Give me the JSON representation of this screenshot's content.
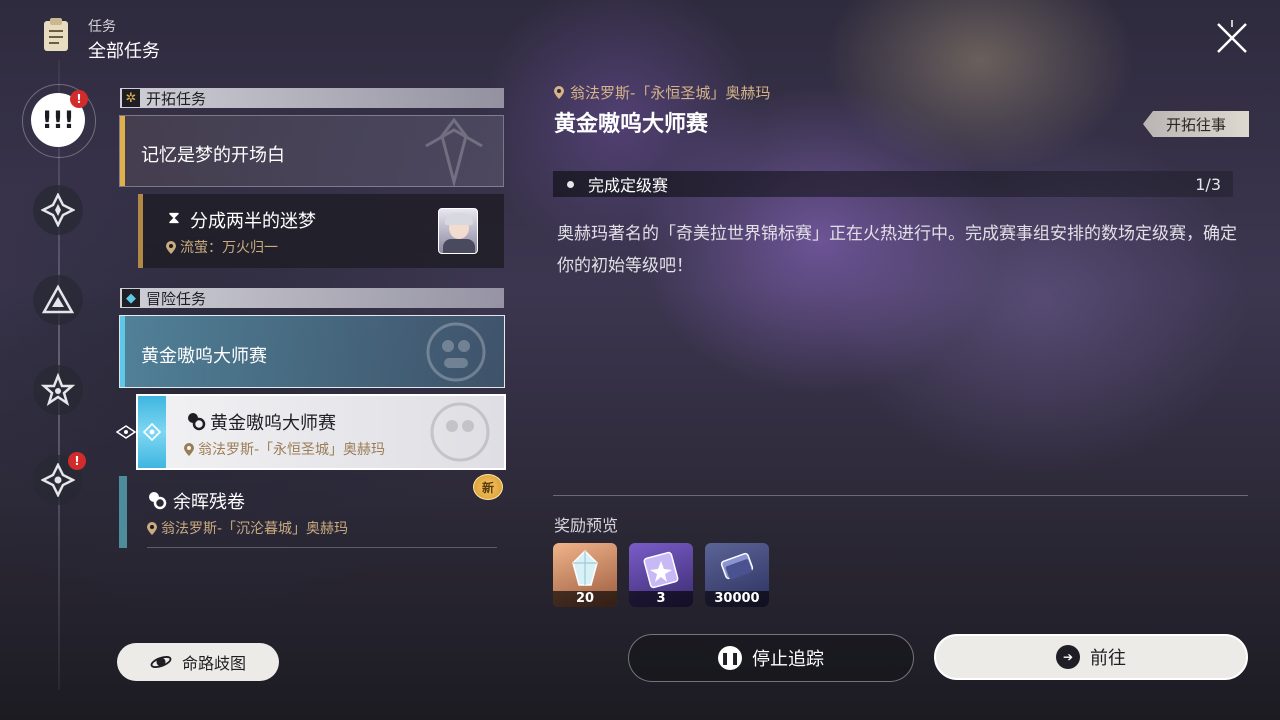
{
  "header": {
    "category": "任务",
    "title": "全部任务",
    "icon": "clipboard-icon",
    "close_icon": "close-icon"
  },
  "sidebar": {
    "items": [
      {
        "name": "all-missions",
        "icon": "exclamation-icon",
        "symbol": "!!!",
        "badge": "!",
        "active": true
      },
      {
        "name": "trailblaze",
        "icon": "diamond-star-icon",
        "symbol": "◈",
        "badge": ""
      },
      {
        "name": "companion",
        "icon": "triangle-icon",
        "symbol": "▲",
        "badge": ""
      },
      {
        "name": "adventure",
        "icon": "star-icon",
        "symbol": "✩",
        "badge": ""
      },
      {
        "name": "daily",
        "icon": "diamond-star-icon",
        "symbol": "◈",
        "badge": "!"
      }
    ]
  },
  "sections": [
    {
      "title": "开拓任务",
      "icon": "trailblaze-gear-icon",
      "color": "#e2b04a"
    },
    {
      "title": "冒险任务",
      "icon": "adventure-diamond-icon",
      "color": "#5ec8e6"
    }
  ],
  "missions": {
    "group1_title": "记忆是梦的开场白",
    "sub1_title": "分成两半的迷梦",
    "sub1_loc": "流萤：万火归一",
    "group2_title": "黄金嗷呜大师赛",
    "sub2_title": "黄金嗷呜大师赛",
    "sub2_loc": "翁法罗斯-「永恒圣城」奥赫玛",
    "sub3_title": "余晖残卷",
    "sub3_loc": "翁法罗斯-「沉沦暮城」奥赫玛",
    "new_badge": "新"
  },
  "detail": {
    "location": "翁法罗斯-「永恒圣城」奥赫玛",
    "title": "黄金嗷呜大师赛",
    "tag_button": "开拓往事",
    "objective": "完成定级赛",
    "progress": "1/3",
    "description": "奥赫玛著名的「奇美拉世界锦标赛」正在火热进行中。完成赛事组安排的数场定级赛，确定你的初始等级吧！",
    "reward_label": "奖励预览",
    "rewards": [
      {
        "icon": "crystal-icon",
        "qty": "20"
      },
      {
        "icon": "star-pass-icon",
        "qty": "3"
      },
      {
        "icon": "credit-icon",
        "qty": "30000"
      }
    ]
  },
  "buttons": {
    "stop": "停止追踪",
    "go": "前往",
    "path": "命路歧图"
  }
}
